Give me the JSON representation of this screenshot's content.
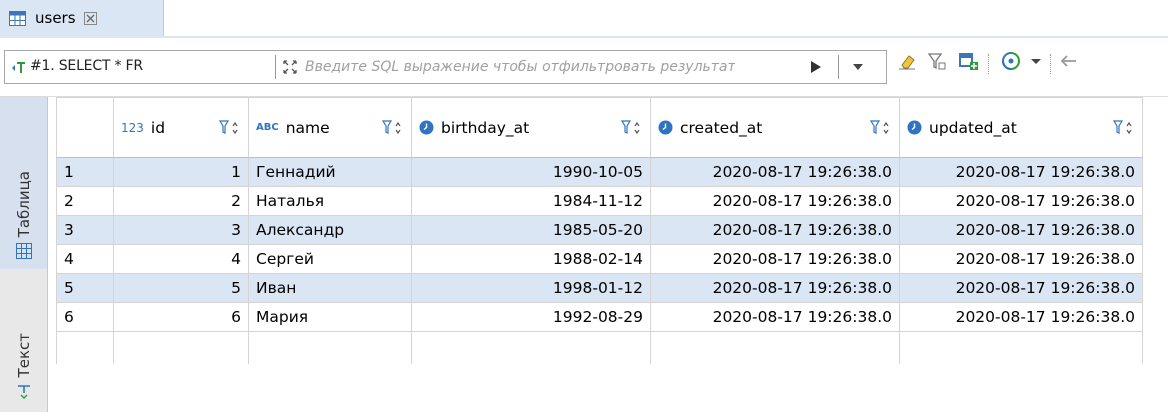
{
  "tab": {
    "label": "users",
    "icon": "table-icon",
    "close_icon": "close-icon"
  },
  "filter": {
    "query_label": "#1. SELECT * FR",
    "placeholder": "Введите SQL выражение чтобы отфильтровать результаты"
  },
  "side_tabs": [
    {
      "label": "Таблица",
      "icon": "table-grid-icon"
    },
    {
      "label": "Текст",
      "icon": "text-icon"
    }
  ],
  "columns": [
    {
      "name": "id",
      "type_icon": "123"
    },
    {
      "name": "name",
      "type_icon": "ABC"
    },
    {
      "name": "birthday_at",
      "type_icon": "clock-icon"
    },
    {
      "name": "created_at",
      "type_icon": "clock-icon"
    },
    {
      "name": "updated_at",
      "type_icon": "clock-icon"
    }
  ],
  "rows": [
    {
      "rownum": "1",
      "id": "1",
      "name": "Геннадий",
      "birthday_at": "1990-10-05",
      "created_at": "2020-08-17 19:26:38.0",
      "updated_at": "2020-08-17 19:26:38.0"
    },
    {
      "rownum": "2",
      "id": "2",
      "name": "Наталья",
      "birthday_at": "1984-11-12",
      "created_at": "2020-08-17 19:26:38.0",
      "updated_at": "2020-08-17 19:26:38.0"
    },
    {
      "rownum": "3",
      "id": "3",
      "name": "Александр",
      "birthday_at": "1985-05-20",
      "created_at": "2020-08-17 19:26:38.0",
      "updated_at": "2020-08-17 19:26:38.0"
    },
    {
      "rownum": "4",
      "id": "4",
      "name": "Сергей",
      "birthday_at": "1988-02-14",
      "created_at": "2020-08-17 19:26:38.0",
      "updated_at": "2020-08-17 19:26:38.0"
    },
    {
      "rownum": "5",
      "id": "5",
      "name": "Иван",
      "birthday_at": "1998-01-12",
      "created_at": "2020-08-17 19:26:38.0",
      "updated_at": "2020-08-17 19:26:38.0"
    },
    {
      "rownum": "6",
      "id": "6",
      "name": "Мария",
      "birthday_at": "1992-08-29",
      "created_at": "2020-08-17 19:26:38.0",
      "updated_at": "2020-08-17 19:26:38.0"
    }
  ],
  "colors": {
    "selected_row": "#dbe6f4",
    "accent": "#2f74c0"
  }
}
